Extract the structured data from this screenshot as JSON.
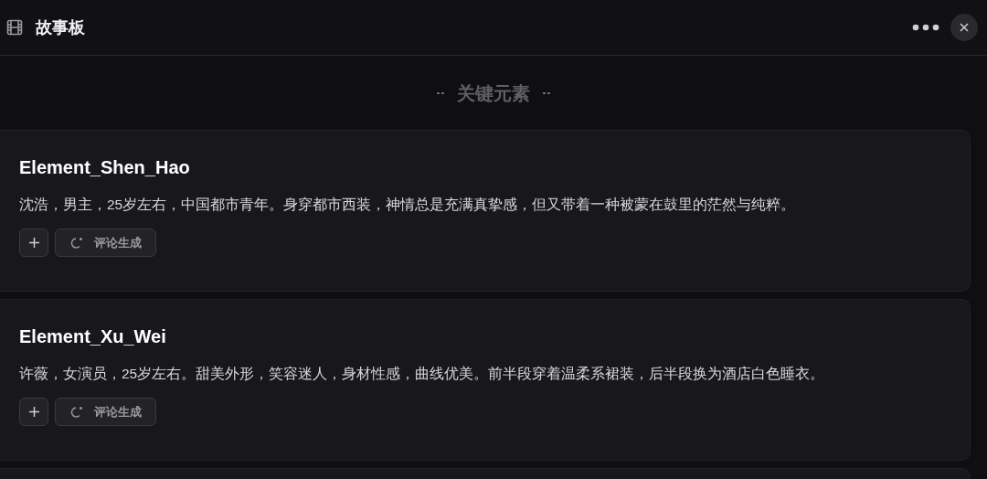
{
  "header": {
    "title": "故事板"
  },
  "section": {
    "title": "关键元素"
  },
  "elements": [
    {
      "name": "Element_Shen_Hao",
      "description": "沈浩，男主，25岁左右，中国都市青年。身穿都市西装，神情总是充满真挚感，但又带着一种被蒙在鼓里的茫然与纯粹。",
      "action": "评论生成"
    },
    {
      "name": "Element_Xu_Wei",
      "description": "许薇，女演员，25岁左右。甜美外形，笑容迷人，身材性感，曲线优美。前半段穿着温柔系裙装，后半段换为酒店白色睡衣。",
      "action": "评论生成"
    }
  ]
}
